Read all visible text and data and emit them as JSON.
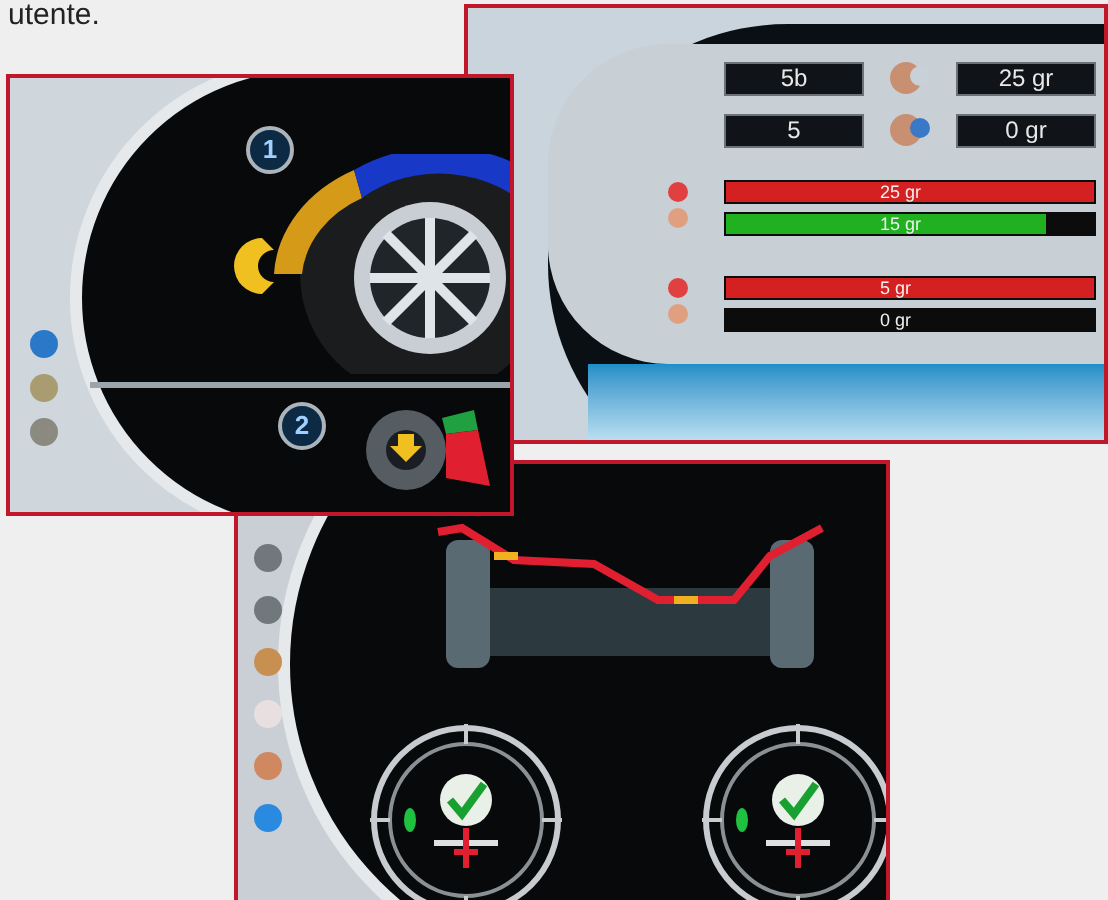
{
  "caption": "utente.",
  "balance_screen": {
    "rows": [
      {
        "value": "5b",
        "weight": "25 gr"
      },
      {
        "value": "5",
        "weight": "0 gr"
      }
    ],
    "bar_groups": [
      {
        "bars": [
          {
            "label": "25 gr",
            "level": 1,
            "color": "#d42020"
          },
          {
            "label": "15 gr",
            "level": 0.87,
            "color": "#20b020"
          }
        ]
      },
      {
        "bars": [
          {
            "label": "5 gr",
            "level": 1,
            "color": "#d42020"
          },
          {
            "label": "0 gr"
          }
        ]
      }
    ]
  },
  "wheel_screen": {
    "steps": [
      {
        "number": "1"
      },
      {
        "number": "2"
      }
    ]
  },
  "alignment_screen": {
    "gauges": [
      {
        "ok": true
      },
      {
        "ok": true
      }
    ]
  }
}
